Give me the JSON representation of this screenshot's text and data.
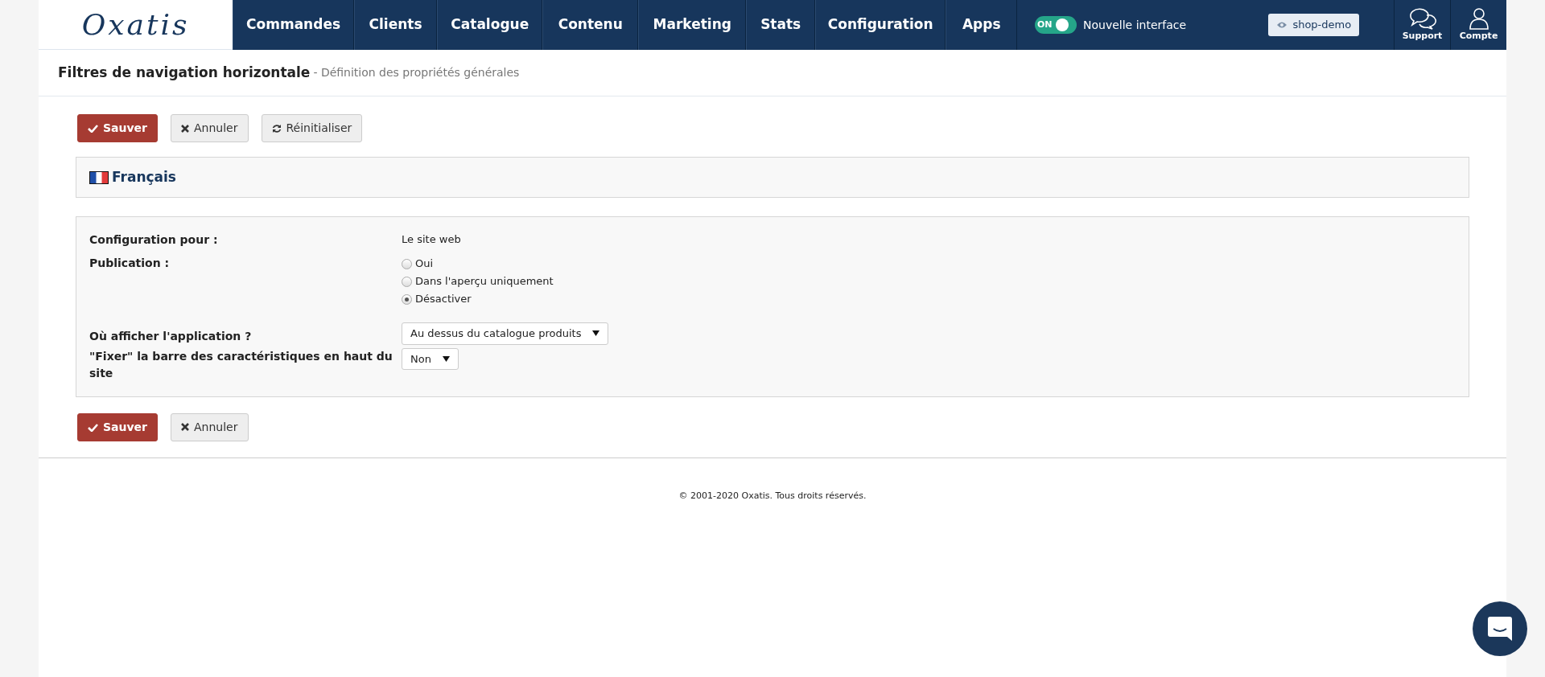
{
  "header": {
    "logo": "Oxatis",
    "nav": [
      {
        "label": "Commandes"
      },
      {
        "label": "Clients"
      },
      {
        "label": "Catalogue"
      },
      {
        "label": "Contenu"
      },
      {
        "label": "Marketing"
      },
      {
        "label": "Stats"
      },
      {
        "label": "Configuration"
      },
      {
        "label": "Apps"
      }
    ],
    "toggle": {
      "label": "ON",
      "on": true,
      "caption": "Nouvelle interface"
    },
    "shop_button": "shop-demo",
    "tools": [
      {
        "kind": "support",
        "label": "Support"
      },
      {
        "kind": "account",
        "label": "Compte"
      }
    ]
  },
  "page_title": {
    "title": "Filtres de navigation horizontale",
    "subtitle": "- Définition des propriétés générales"
  },
  "top_buttons": [
    {
      "kind": "save",
      "label": "Sauver"
    },
    {
      "kind": "cancel",
      "label": "Annuler"
    },
    {
      "kind": "reset",
      "label": "Réinitialiser"
    }
  ],
  "language": "Français",
  "form": [
    {
      "kind": "text",
      "label": "Configuration pour :",
      "value": "Le site web"
    },
    {
      "kind": "radio",
      "label": "Publication :",
      "options": [
        {
          "label": "Oui",
          "selected": false
        },
        {
          "label": "Dans l'aperçu uniquement",
          "selected": false
        },
        {
          "label": "Désactiver",
          "selected": true
        }
      ]
    },
    {
      "kind": "select",
      "label": "Où afficher l'application ?",
      "value": "Au dessus du catalogue produits"
    },
    {
      "kind": "select",
      "label": "\"Fixer\" la barre des caractéristiques en haut du site",
      "value": "Non"
    }
  ],
  "bottom_buttons": [
    {
      "kind": "save",
      "label": "Sauver"
    },
    {
      "kind": "cancel",
      "label": "Annuler"
    }
  ],
  "footer": "© 2001-2020 Oxatis. Tous droits réservés."
}
